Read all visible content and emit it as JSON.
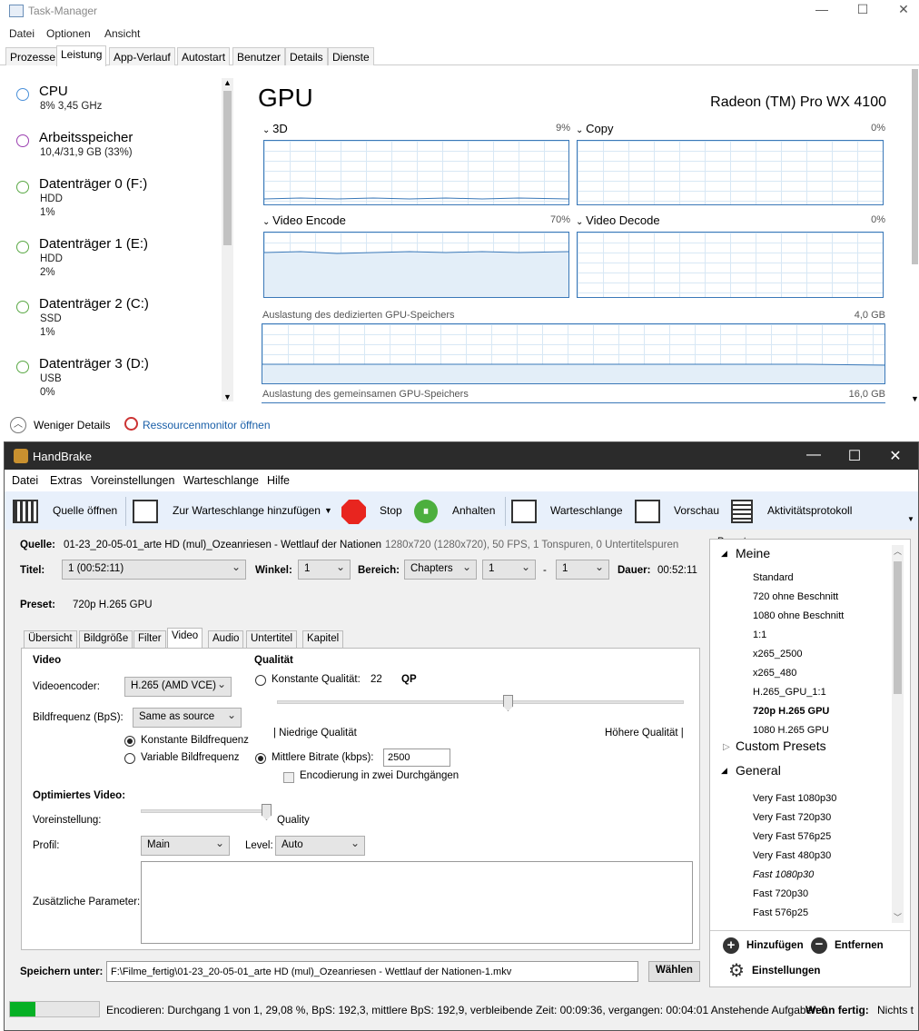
{
  "task_manager": {
    "title": "Task-Manager",
    "menu": [
      "Datei",
      "Optionen",
      "Ansicht"
    ],
    "tabs": [
      "Prozesse",
      "Leistung",
      "App-Verlauf",
      "Autostart",
      "Benutzer",
      "Details",
      "Dienste"
    ],
    "active_tab": "Leistung",
    "sidebar": [
      {
        "name": "CPU",
        "line1": "8% 3,45 GHz",
        "line2": "",
        "color": "#4a90d9"
      },
      {
        "name": "Arbeitsspeicher",
        "line1": "10,4/31,9 GB (33%)",
        "line2": "",
        "color": "#9b3fb0"
      },
      {
        "name": "Datenträger 0 (F:)",
        "line1": "HDD",
        "line2": "1%",
        "color": "#5aa845"
      },
      {
        "name": "Datenträger 1 (E:)",
        "line1": "HDD",
        "line2": "2%",
        "color": "#5aa845"
      },
      {
        "name": "Datenträger 2 (C:)",
        "line1": "SSD",
        "line2": "1%",
        "color": "#5aa845"
      },
      {
        "name": "Datenträger 3 (D:)",
        "line1": "USB",
        "line2": "0%",
        "color": "#5aa845"
      }
    ],
    "gpu": {
      "title": "GPU",
      "model": "Radeon (TM) Pro WX 4100",
      "engines": [
        {
          "label": "3D",
          "percent": "9%"
        },
        {
          "label": "Copy",
          "percent": "0%"
        },
        {
          "label": "Video Encode",
          "percent": "70%"
        },
        {
          "label": "Video Decode",
          "percent": "0%"
        }
      ],
      "dedicated_label": "Auslastung des dedizierten GPU-Speichers",
      "dedicated_max": "4,0 GB",
      "shared_label": "Auslastung des gemeinsamen GPU-Speichers",
      "shared_max": "16,0 GB"
    },
    "footer": {
      "less_details": "Weniger Details",
      "resource_monitor": "Ressourcenmonitor öffnen"
    }
  },
  "handbrake": {
    "title": "HandBrake",
    "menu": [
      "Datei",
      "Extras",
      "Voreinstellungen",
      "Warteschlange",
      "Hilfe"
    ],
    "toolbar": {
      "open_source": "Quelle öffnen",
      "add_queue": "Zur Warteschlange hinzufügen",
      "stop": "Stop",
      "pause": "Anhalten",
      "queue": "Warteschlange",
      "preview": "Vorschau",
      "activity": "Aktivitätsprotokoll"
    },
    "source": {
      "label": "Quelle:",
      "name": "01-23_20-05-01_arte HD (mul)_Ozeanriesen - Wettlauf der Nationen",
      "info": "1280x720 (1280x720), 50 FPS, 1 Tonspuren, 0 Untertitelspuren"
    },
    "title_row": {
      "title_label": "Titel:",
      "title_value": "1 (00:52:11)",
      "angle_label": "Winkel:",
      "angle_value": "1",
      "range_label": "Bereich:",
      "range_value": "Chapters",
      "range_from": "1",
      "range_sep": "-",
      "range_to": "1",
      "duration_label": "Dauer:",
      "duration_value": "00:52:11"
    },
    "preset": {
      "label": "Preset:",
      "value": "720p H.265 GPU"
    },
    "tabs": [
      "Übersicht",
      "Bildgröße",
      "Filter",
      "Video",
      "Audio",
      "Untertitel",
      "Kapitel"
    ],
    "active_tab": "Video",
    "video": {
      "section": "Video",
      "encoder_label": "Videoencoder:",
      "encoder_value": "H.265 (AMD VCE)",
      "fps_label": "Bildfrequenz (BpS):",
      "fps_value": "Same as source",
      "const_fps": "Konstante Bildfrequenz",
      "var_fps": "Variable Bildfrequenz"
    },
    "quality": {
      "section": "Qualität",
      "const_quality": "Konstante Qualität:",
      "const_value": "22",
      "qp": "QP",
      "low": "| Niedrige Qualität",
      "high": "Höhere Qualität |",
      "avg_bitrate": "Mittlere Bitrate (kbps):",
      "bitrate_value": "2500",
      "two_pass": "Encodierung in zwei Durchgängen"
    },
    "optimized": {
      "section": "Optimiertes Video:",
      "preset_label": "Voreinstellung:",
      "preset_value": "Quality",
      "profile_label": "Profil:",
      "profile_value": "Main",
      "level_label": "Level:",
      "level_value": "Auto",
      "extra_label": "Zusätzliche Parameter:"
    },
    "save": {
      "label": "Speichern unter:",
      "path": "F:\\Filme_fertig\\01-23_20-05-01_arte HD (mul)_Ozeanriesen - Wettlauf der Nationen-1.mkv",
      "browse": "Wählen"
    },
    "presets": {
      "header": "Presets",
      "groups": [
        {
          "name": "Meine",
          "expanded": true,
          "items": [
            "Standard",
            "720 ohne Beschnitt",
            "1080 ohne Beschnitt",
            "1:1",
            "x265_2500",
            "x265_480",
            "H.265_GPU_1:1",
            "720p H.265 GPU",
            "1080 H.265 GPU"
          ]
        },
        {
          "name": "Custom Presets",
          "expanded": false,
          "items": []
        },
        {
          "name": "General",
          "expanded": true,
          "items": [
            "Very Fast 1080p30",
            "Very Fast 720p30",
            "Very Fast 576p25",
            "Very Fast 480p30",
            "Fast 1080p30",
            "Fast 720p30",
            "Fast 576p25"
          ]
        }
      ],
      "selected": "720p H.265 GPU",
      "italic": "Fast 1080p30",
      "add": "Hinzufügen",
      "remove": "Entfernen",
      "settings": "Einstellungen"
    },
    "status": {
      "progress": 0.29,
      "text": "Encodieren: Durchgang 1 von 1, 29,08 %, BpS: 192,3, mittlere BpS: 192,9, verbleibende Zeit: 00:09:36, vergangen: 00:04:01 Anstehende Aufgaben 0",
      "when_done_label": "Wenn fertig:",
      "when_done_value": "Nichts t"
    }
  }
}
